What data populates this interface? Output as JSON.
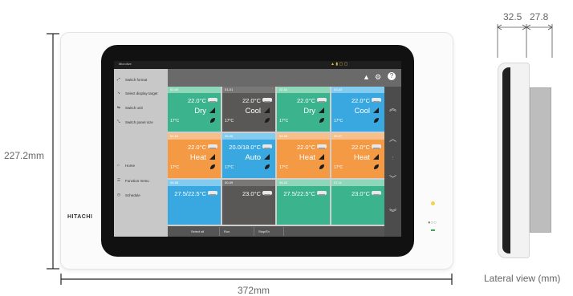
{
  "dimensions": {
    "height_label": "227.2mm",
    "width_label": "372mm",
    "side_depth_front": "32.5",
    "side_depth_back": "27.8",
    "lateral_caption": "Lateral view (mm)"
  },
  "device": {
    "brand": "HITACHI"
  },
  "screen": {
    "status_left": "Microlive",
    "sidebar_items": [
      "Switch format",
      "Select display target",
      "Switch unit",
      "Switch panel size",
      "Home",
      "Function menu",
      "Schedule"
    ],
    "tiles": [
      {
        "id": "00-00",
        "temp": "22.0°C",
        "mode": "Dry",
        "room": "17°C",
        "color": "#3bb38c",
        "hdr": "#8fd7b9"
      },
      {
        "id": "01-01",
        "temp": "22.0°C",
        "mode": "Cool",
        "room": "17°C",
        "color": "#5a5757",
        "hdr": "#7a7777"
      },
      {
        "id": "02-02",
        "temp": "22.0°C",
        "mode": "Dry",
        "room": "17°C",
        "color": "#3bb38c",
        "hdr": "#8fd7b9"
      },
      {
        "id": "03-03",
        "temp": "22.0°C",
        "mode": "Cool",
        "room": "17°C",
        "color": "#3aa8e0",
        "hdr": "#84ccef"
      },
      {
        "id": "04-04",
        "temp": "22.0°C",
        "mode": "Heat",
        "room": "17°C",
        "color": "#f49a45",
        "hdr": "#f7c08b"
      },
      {
        "id": "05-05",
        "temp": "20.0/18.0°C",
        "mode": "Auto",
        "room": "17°C",
        "color": "#3aa8e0",
        "hdr": "#84ccef"
      },
      {
        "id": "06-06",
        "temp": "22.0°C",
        "mode": "Heat",
        "room": "17°C",
        "color": "#f49a45",
        "hdr": "#f7c08b"
      },
      {
        "id": "05-07",
        "temp": "22.0°C",
        "mode": "Heat",
        "room": "17°C",
        "color": "#f49a45",
        "hdr": "#f7c08b"
      },
      {
        "id": "06-08",
        "temp": "27.5/22.5°C",
        "mode": "",
        "room": "",
        "color": "#3aa8e0",
        "hdr": "#84ccef"
      },
      {
        "id": "00-09",
        "temp": "23.0°C",
        "mode": "",
        "room": "",
        "color": "#5a5757",
        "hdr": "#7a7777"
      },
      {
        "id": "06-10",
        "temp": "27.5/22.5°C",
        "mode": "",
        "room": "",
        "color": "#3bb38c",
        "hdr": "#8fd7b9"
      },
      {
        "id": "07-11",
        "temp": "23.0°C",
        "mode": "",
        "room": "",
        "color": "#3bb38c",
        "hdr": "#8fd7b9"
      }
    ],
    "bottom_buttons": [
      "Select all",
      "Run",
      "Stop/Ev"
    ]
  },
  "icons": {
    "topbar": [
      "warning-icon",
      "gear-icon",
      "help-icon"
    ],
    "rightnav": [
      "chevron-double-up-icon",
      "chevron-up-icon",
      "chevron-down-icon",
      "chevron-double-down-icon"
    ]
  }
}
